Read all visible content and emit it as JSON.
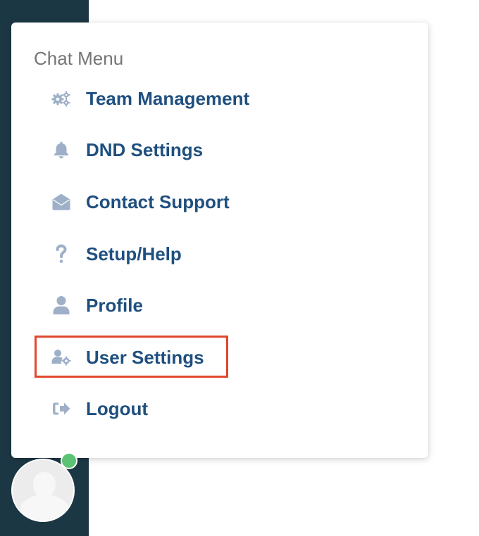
{
  "menu": {
    "title": "Chat Menu",
    "items": [
      {
        "label": "Team Management",
        "icon": "gears-icon"
      },
      {
        "label": "DND Settings",
        "icon": "bell-icon"
      },
      {
        "label": "Contact Support",
        "icon": "envelope-open-icon"
      },
      {
        "label": "Setup/Help",
        "icon": "question-icon"
      },
      {
        "label": "Profile",
        "icon": "user-icon"
      },
      {
        "label": "User Settings",
        "icon": "user-gear-icon"
      },
      {
        "label": "Logout",
        "icon": "sign-out-icon"
      }
    ],
    "highlighted_item": "User Settings"
  },
  "user": {
    "status": "online",
    "status_color": "#5cc374"
  },
  "colors": {
    "sidebar": "#1c3744",
    "label": "#1f4f7f",
    "icon": "#9db0c8",
    "highlight": "#e0482e"
  }
}
